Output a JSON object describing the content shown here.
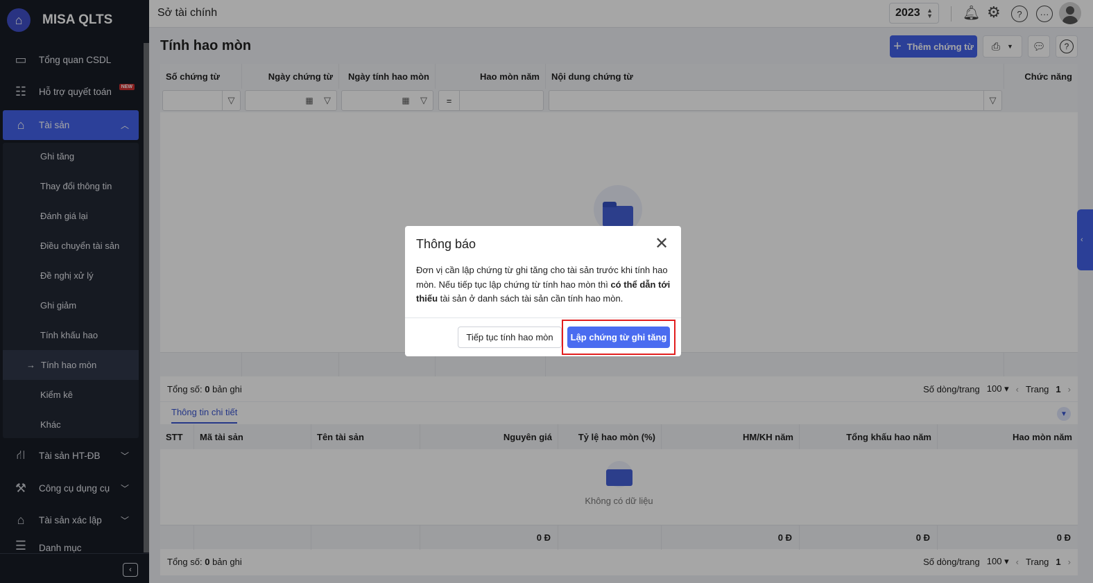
{
  "sidebar": {
    "brand": "MISA QLTS",
    "items": [
      {
        "label": "Tổng quan CSDL"
      },
      {
        "label": "Hỗ trợ quyết toán",
        "badge": "NEW"
      },
      {
        "label": "Tài sản"
      },
      {
        "label": "Tài sản HT-ĐB"
      },
      {
        "label": "Công cụ dụng cụ"
      },
      {
        "label": "Tài sản xác lập"
      },
      {
        "label": "Danh mục"
      }
    ],
    "sub_items": [
      "Ghi tăng",
      "Thay đổi thông tin",
      "Đánh giá lại",
      "Điều chuyển tài sản",
      "Đề nghị xử lý",
      "Ghi giảm",
      "Tính khấu hao",
      "Tính hao mòn",
      "Kiểm kê",
      "Khác"
    ]
  },
  "header": {
    "title": "Sở tài chính",
    "year": "2023"
  },
  "page": {
    "title": "Tính hao mòn",
    "add_button": "Thêm chứng từ"
  },
  "main_table": {
    "columns": [
      "Số chứng từ",
      "Ngày chứng từ",
      "Ngày tính hao mòn",
      "Hao mòn năm",
      "Nội dung chứng từ",
      "Chức năng"
    ],
    "operator": "="
  },
  "summary": {
    "total_prefix": "Tổng số:",
    "total_count": "0",
    "total_suffix": "bản ghi",
    "rows_label": "Số dòng/trang",
    "rows_value": "100",
    "page_label": "Trang",
    "page_value": "1"
  },
  "detail": {
    "tab": "Thông tin chi tiết",
    "columns": [
      "STT",
      "Mã tài sản",
      "Tên tài sản",
      "Nguyên giá",
      "Tỷ lệ hao mòn (%)",
      "HM/KH năm",
      "Tổng khấu hao năm",
      "Hao mòn năm"
    ],
    "empty": "Không có dữ liệu",
    "totals": [
      "0 Đ",
      "0 Đ",
      "0 Đ",
      "0 Đ"
    ]
  },
  "dialog": {
    "title": "Thông báo",
    "body_1": "Đơn vị cần lập chứng từ ghi tăng cho tài sản trước khi tính hao mòn. Nếu tiếp tục lập chứng từ tính hao mòn thì ",
    "body_bold": "có thể dẫn tới thiếu",
    "body_2": " tài sản ở danh sách tài sản cần tính hao mòn.",
    "continue_button": "Tiếp tục tính hao mòn",
    "create_button": "Lập chứng từ ghi tăng"
  }
}
